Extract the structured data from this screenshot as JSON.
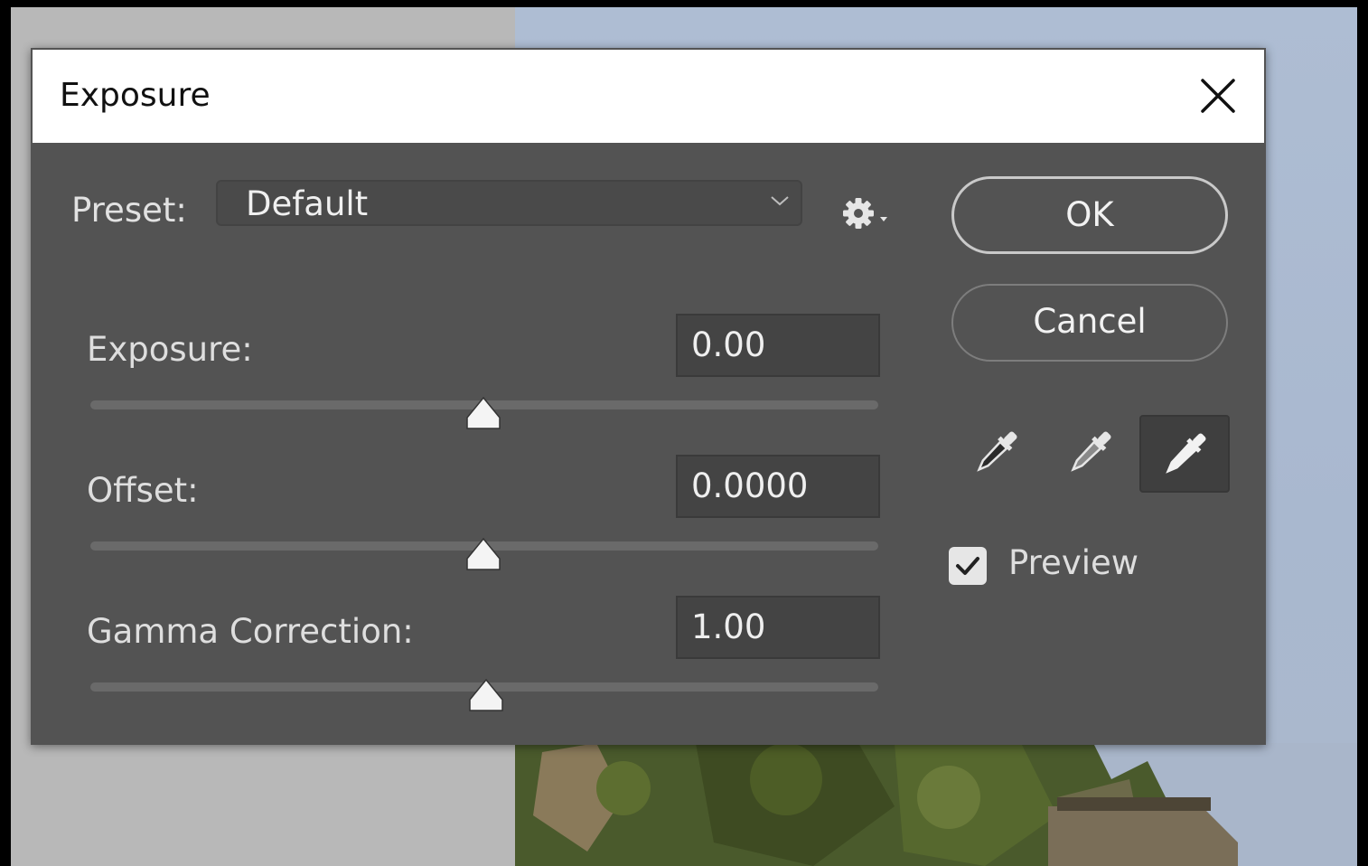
{
  "dialog": {
    "title": "Exposure",
    "close_icon": "close-icon"
  },
  "preset": {
    "label": "Preset:",
    "value": "Default",
    "dropdown_icon": "chevron-down-icon",
    "options_icon": "gear-icon"
  },
  "controls": [
    {
      "label": "Exposure:",
      "value": "0.00",
      "slider_position": 0.5
    },
    {
      "label": "Offset:",
      "value": "0.0000",
      "slider_position": 0.5
    },
    {
      "label": "Gamma Correction:",
      "value": "1.00",
      "slider_position": 0.5
    }
  ],
  "buttons": {
    "ok_label": "OK",
    "cancel_label": "Cancel"
  },
  "eyedroppers": [
    {
      "name": "black-point-eyedropper-icon",
      "selected": false
    },
    {
      "name": "gray-point-eyedropper-icon",
      "selected": false
    },
    {
      "name": "white-point-eyedropper-icon",
      "selected": true
    }
  ],
  "preview": {
    "label": "Preview",
    "checked": true
  },
  "colors": {
    "dialog_bg": "#535353",
    "field_bg": "#444444",
    "text": "#dedede"
  }
}
